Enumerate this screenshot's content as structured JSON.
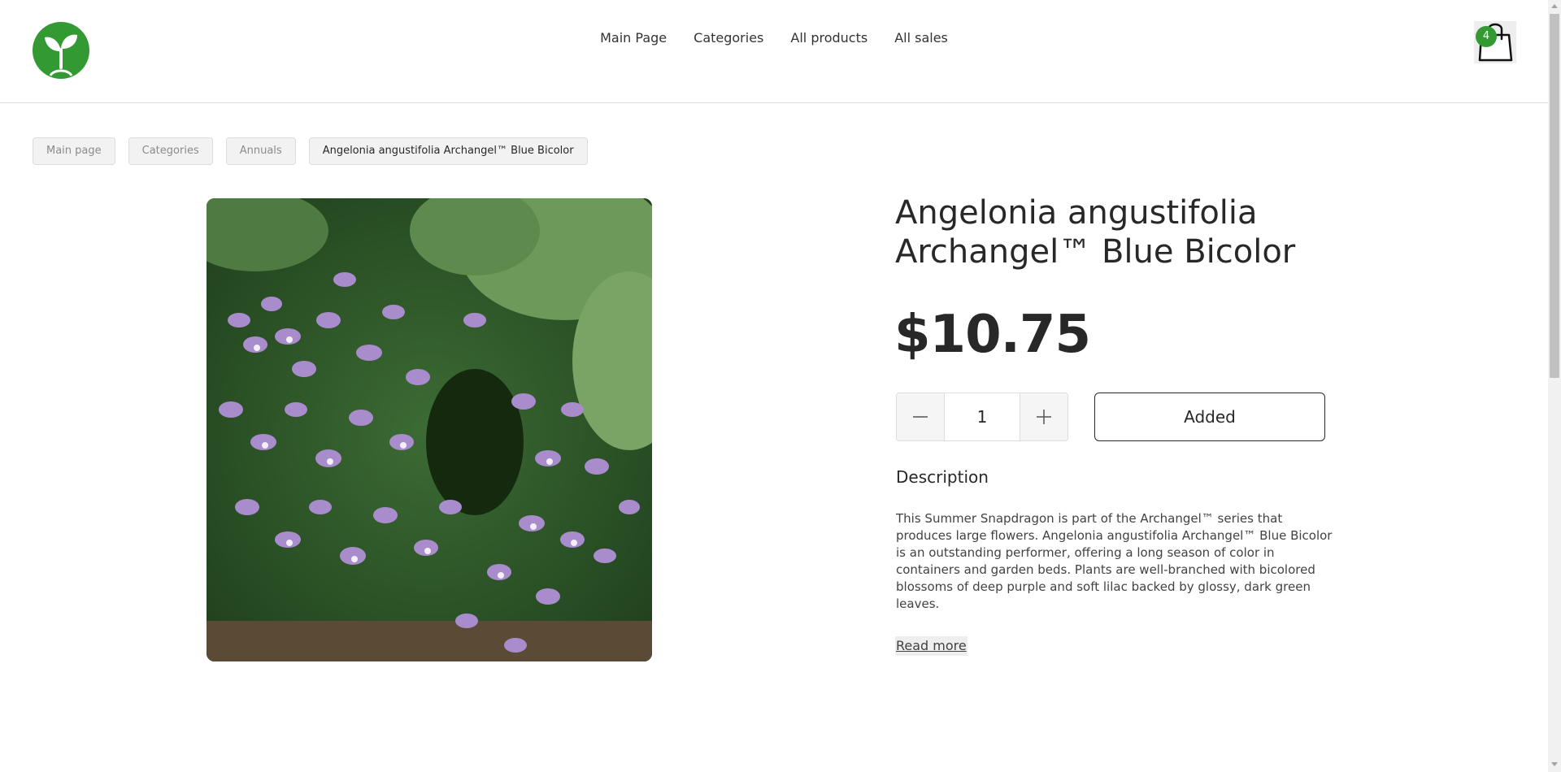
{
  "header": {
    "logo_icon": "sprout-icon",
    "nav": {
      "main_page": "Main Page",
      "categories": "Categories",
      "all_products": "All products",
      "all_sales": "All sales"
    },
    "cart": {
      "icon": "shopping-bag-icon",
      "count": "4"
    }
  },
  "breadcrumbs": {
    "main_page": "Main page",
    "categories": "Categories",
    "annuals": "Annuals",
    "current": "Angelonia angustifolia Archangel™ Blue Bicolor"
  },
  "product": {
    "image_icon": "product-photo",
    "title": "Angelonia angustifolia Archangel™ Blue Bicolor",
    "price": "$10.75",
    "quantity": "1",
    "decrease_icon": "minus-icon",
    "increase_icon": "plus-icon",
    "add_button_label": "Added",
    "description_title": "Description",
    "description": "This Summer Snapdragon is part of the Archangel™ series that produces large flowers. Angelonia angustifolia Archangel™ Blue Bicolor is an outstanding performer, offering a long season of color in containers and garden beds. Plants are well-branched with bicolored blossoms of deep purple and soft lilac backed by glossy, dark green leaves.",
    "read_more": "Read more"
  },
  "colors": {
    "brand_green": "#339933",
    "text": "#282828",
    "border": "#dddddd"
  }
}
